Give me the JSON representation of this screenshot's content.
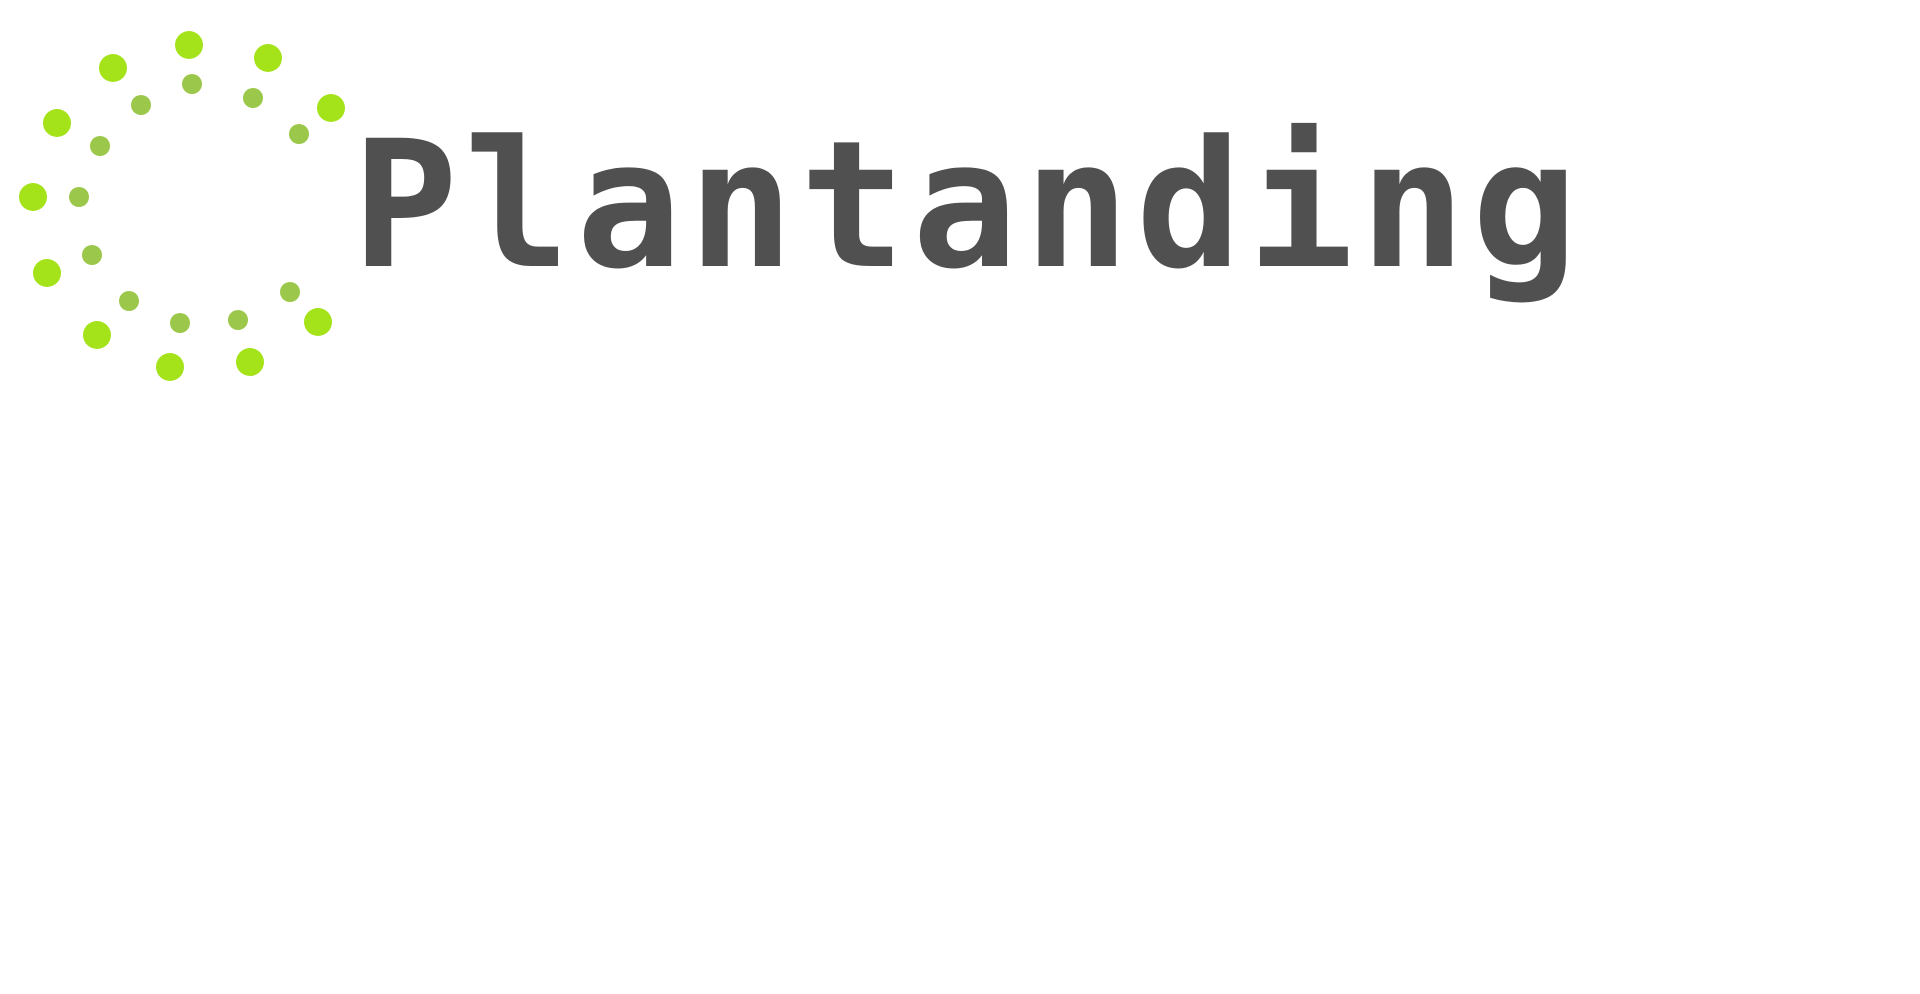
{
  "logo": {
    "wordmark": "Plantanding",
    "icon": "dotted-ring-icon",
    "colors": {
      "wordmark": "#505050",
      "outer_dots": "#a4e31a",
      "inner_dots": "#9bc84a",
      "background": "#ffffff"
    }
  }
}
